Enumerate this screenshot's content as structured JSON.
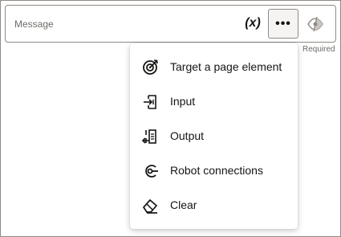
{
  "field": {
    "label": "Message",
    "variable_button": "(x)",
    "more_button": "•••",
    "toggle_icon": "eye-slash-icon",
    "required_text": "Required"
  },
  "menu": {
    "items": [
      {
        "label": "Target a page element",
        "icon": "target-icon"
      },
      {
        "label": "Input",
        "icon": "input-icon"
      },
      {
        "label": "Output",
        "icon": "output-icon"
      },
      {
        "label": "Robot connections",
        "icon": "robot-connection-icon"
      },
      {
        "label": "Clear",
        "icon": "eraser-icon"
      }
    ]
  },
  "colors": {
    "border": "#8f8b85",
    "text": "#161513",
    "muted_text": "#6f6b67",
    "button_bg": "#f5f4f2"
  }
}
